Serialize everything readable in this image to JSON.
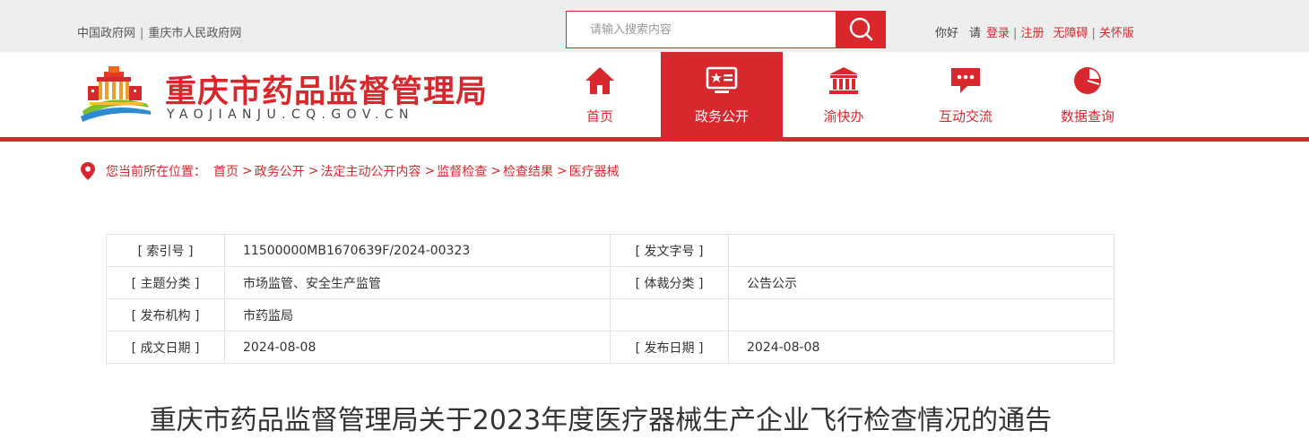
{
  "topbar": {
    "links": [
      "中国政府网",
      "重庆市人民政府网"
    ],
    "search_placeholder": "请输入搜索内容",
    "greeting": "你好",
    "please": "请",
    "login": "登录",
    "register": "注册",
    "accessibility": "无障碍",
    "care_mode": "关怀版"
  },
  "header": {
    "title": "重庆市药品监督管理局",
    "domain": "YAOJIANJU.CQ.GOV.CN"
  },
  "nav": [
    {
      "label": "首页",
      "icon": "home-icon",
      "active": false
    },
    {
      "label": "政务公开",
      "icon": "monitor-star-icon",
      "active": true
    },
    {
      "label": "渝快办",
      "icon": "government-building-icon",
      "active": false
    },
    {
      "label": "互动交流",
      "icon": "chat-bubble-icon",
      "active": false
    },
    {
      "label": "数据查询",
      "icon": "pie-chart-icon",
      "active": false
    }
  ],
  "breadcrumb": {
    "prefix": "您当前所在位置：",
    "items": [
      "首页",
      "政务公开",
      "法定主动公开内容",
      "监督检查",
      "检查结果",
      "医疗器械"
    ]
  },
  "info_table": {
    "rows": [
      {
        "k1": "[ 索引号 ]",
        "v1": "11500000MB1670639F/2024-00323",
        "k2": "[ 发文字号 ]",
        "v2": ""
      },
      {
        "k1": "[ 主题分类 ]",
        "v1": "市场监管、安全生产监管",
        "k2": "[ 体裁分类 ]",
        "v2": "公告公示"
      },
      {
        "k1": "[ 发布机构 ]",
        "v1": "市药监局",
        "k2": "",
        "v2": ""
      },
      {
        "k1": "[ 成文日期 ]",
        "v1": "2024-08-08",
        "k2": "[ 发布日期 ]",
        "v2": "2024-08-08"
      }
    ]
  },
  "article": {
    "title": "重庆市药品监督管理局关于2023年度医疗器械生产企业飞行检查情况的通告"
  },
  "colors": {
    "brand_red": "#d9282d",
    "topbar_bg": "#eeeeee"
  }
}
